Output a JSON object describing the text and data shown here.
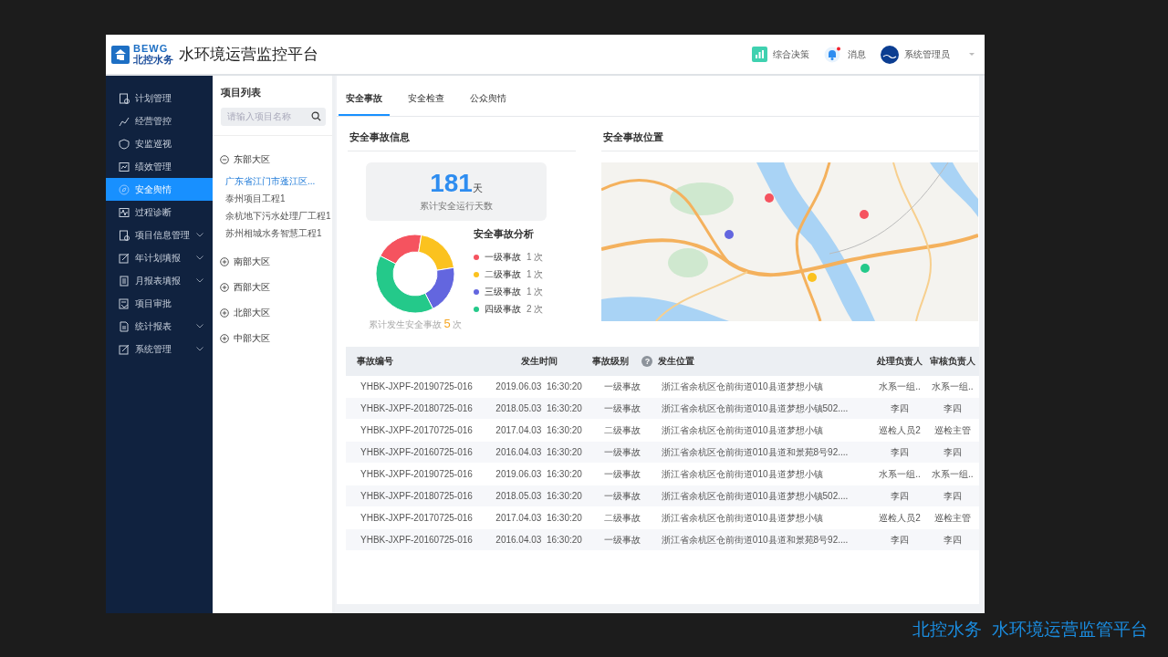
{
  "header": {
    "logo_en": "BEWG",
    "logo_cn": "北控水务",
    "title": "水环境运营监控平台",
    "actions": [
      {
        "kind": "decision",
        "label": "综合决策"
      },
      {
        "kind": "message",
        "label": "消息",
        "unread": true
      },
      {
        "kind": "user",
        "label": "系统管理员"
      }
    ]
  },
  "sidebar": {
    "items": [
      {
        "label": "计划管理",
        "selected": false,
        "expandable": false
      },
      {
        "label": "经营管控",
        "selected": false,
        "expandable": false
      },
      {
        "label": "安监巡视",
        "selected": false,
        "expandable": false
      },
      {
        "label": "绩效管理",
        "selected": false,
        "expandable": false
      },
      {
        "label": "安全舆情",
        "selected": true,
        "expandable": false
      },
      {
        "label": "过程诊断",
        "selected": false,
        "expandable": false
      },
      {
        "label": "项目信息管理",
        "selected": false,
        "expandable": true
      },
      {
        "label": "年计划填报",
        "selected": false,
        "expandable": true
      },
      {
        "label": "月报表填报",
        "selected": false,
        "expandable": true
      },
      {
        "label": "项目审批",
        "selected": false,
        "expandable": false
      },
      {
        "label": "统计报表",
        "selected": false,
        "expandable": true
      },
      {
        "label": "系统管理",
        "selected": false,
        "expandable": true
      }
    ]
  },
  "project_list": {
    "title": "项目列表",
    "search": {
      "placeholder": "请输入项目名称"
    },
    "regions": [
      {
        "label": "东部大区",
        "expanded": true,
        "children": [
          {
            "label": "广东省江门市蓬江区...",
            "selected": true
          },
          {
            "label": "泰州项目工程1",
            "selected": false
          },
          {
            "label": "余杭地下污水处理厂工程1",
            "selected": false
          },
          {
            "label": "苏州相城水务智慧工程1",
            "selected": false
          }
        ]
      },
      {
        "label": "南部大区",
        "expanded": false
      },
      {
        "label": "西部大区",
        "expanded": false
      },
      {
        "label": "北部大区",
        "expanded": false
      },
      {
        "label": "中部大区",
        "expanded": false
      }
    ]
  },
  "tabs": [
    {
      "label": "安全事故",
      "selected": true
    },
    {
      "label": "安全检查",
      "selected": false
    },
    {
      "label": "公众舆情",
      "selected": false
    }
  ],
  "info": {
    "title": "安全事故信息",
    "days": "181",
    "days_unit": "天",
    "days_label": "累计安全运行天数",
    "analysis_title": "安全事故分析",
    "legend": [
      {
        "count": "1 次",
        "color": "#f5535f"
      },
      {
        "count": "1 次",
        "color": "#fbc21f"
      },
      {
        "count": "1 次",
        "color": "#6366df"
      },
      {
        "count": "2 次",
        "color": "#24c98a"
      }
    ],
    "chart_data": {
      "type": "donut",
      "categories": [
        "一级事故",
        "二级事故",
        "三级事故",
        "四级事故"
      ],
      "values": [
        20,
        20,
        20,
        40
      ]
    },
    "total_label": "累计发生安全事故",
    "total": "5",
    "total_unit": "次"
  },
  "location": {
    "title": "安全事故位置"
  },
  "table": {
    "help_mark": "?",
    "columns": [
      "事故编号",
      "发生时间",
      "事故级别",
      "发生位置",
      "处理负责人",
      "审核负责人"
    ],
    "rows": [
      [
        "YHBK-JXPF-20190725-016",
        "2019.06.03  16:30:20",
        "一级事故",
        "浙江省余杭区仓前街道010县道梦想小镇",
        "水系一组..",
        "水系一组.."
      ],
      [
        "YHBK-JXPF-20180725-016",
        "2018.05.03  16:30:20",
        "一级事故",
        "浙江省余杭区仓前街道010县道梦想小镇502....",
        "李四",
        "李四"
      ],
      [
        "YHBK-JXPF-20170725-016",
        "2017.04.03  16:30:20",
        "二级事故",
        "浙江省余杭区仓前街道010县道梦想小镇",
        "巡检人员2",
        "巡检主管"
      ],
      [
        "YHBK-JXPF-20160725-016",
        "2016.04.03  16:30:20",
        "一级事故",
        "浙江省余杭区仓前街道010县道和景苑8号92....",
        "李四",
        "李四"
      ],
      [
        "YHBK-JXPF-20190725-016",
        "2019.06.03  16:30:20",
        "一级事故",
        "浙江省余杭区仓前街道010县道梦想小镇",
        "水系一组..",
        "水系一组.."
      ],
      [
        "YHBK-JXPF-20180725-016",
        "2018.05.03  16:30:20",
        "一级事故",
        "浙江省余杭区仓前街道010县道梦想小镇502....",
        "李四",
        "李四"
      ],
      [
        "YHBK-JXPF-20170725-016",
        "2017.04.03  16:30:20",
        "二级事故",
        "浙江省余杭区仓前街道010县道梦想小镇",
        "巡检人员2",
        "巡检主管"
      ],
      [
        "YHBK-JXPF-20160725-016",
        "2016.04.03  16:30:20",
        "一级事故",
        "浙江省余杭区仓前街道010县道和景苑8号92....",
        "李四",
        "李四"
      ]
    ]
  },
  "caption": "北控水务  水环境运营监管平台"
}
